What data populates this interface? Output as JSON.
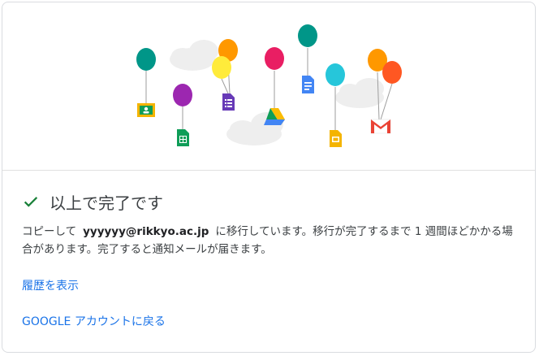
{
  "status": {
    "title": "以上で完了です"
  },
  "message": {
    "before": "コピーして",
    "email": "yyyyyy@rikkyo.ac.jp",
    "after": "に移行しています。移行が完了するまで 1 週間ほどかかる場合があります。完了すると通知メールが届きます。"
  },
  "links": {
    "history": "履歴を表示",
    "back": "GOOGLE アカウントに戻る"
  },
  "colors": {
    "accent": "#1a73e8",
    "success": "#188038"
  },
  "icons": [
    "classroom-icon",
    "sheets-icon",
    "forms-icon",
    "drive-icon",
    "docs-icon",
    "slides-icon",
    "gmail-icon",
    "check-icon"
  ]
}
